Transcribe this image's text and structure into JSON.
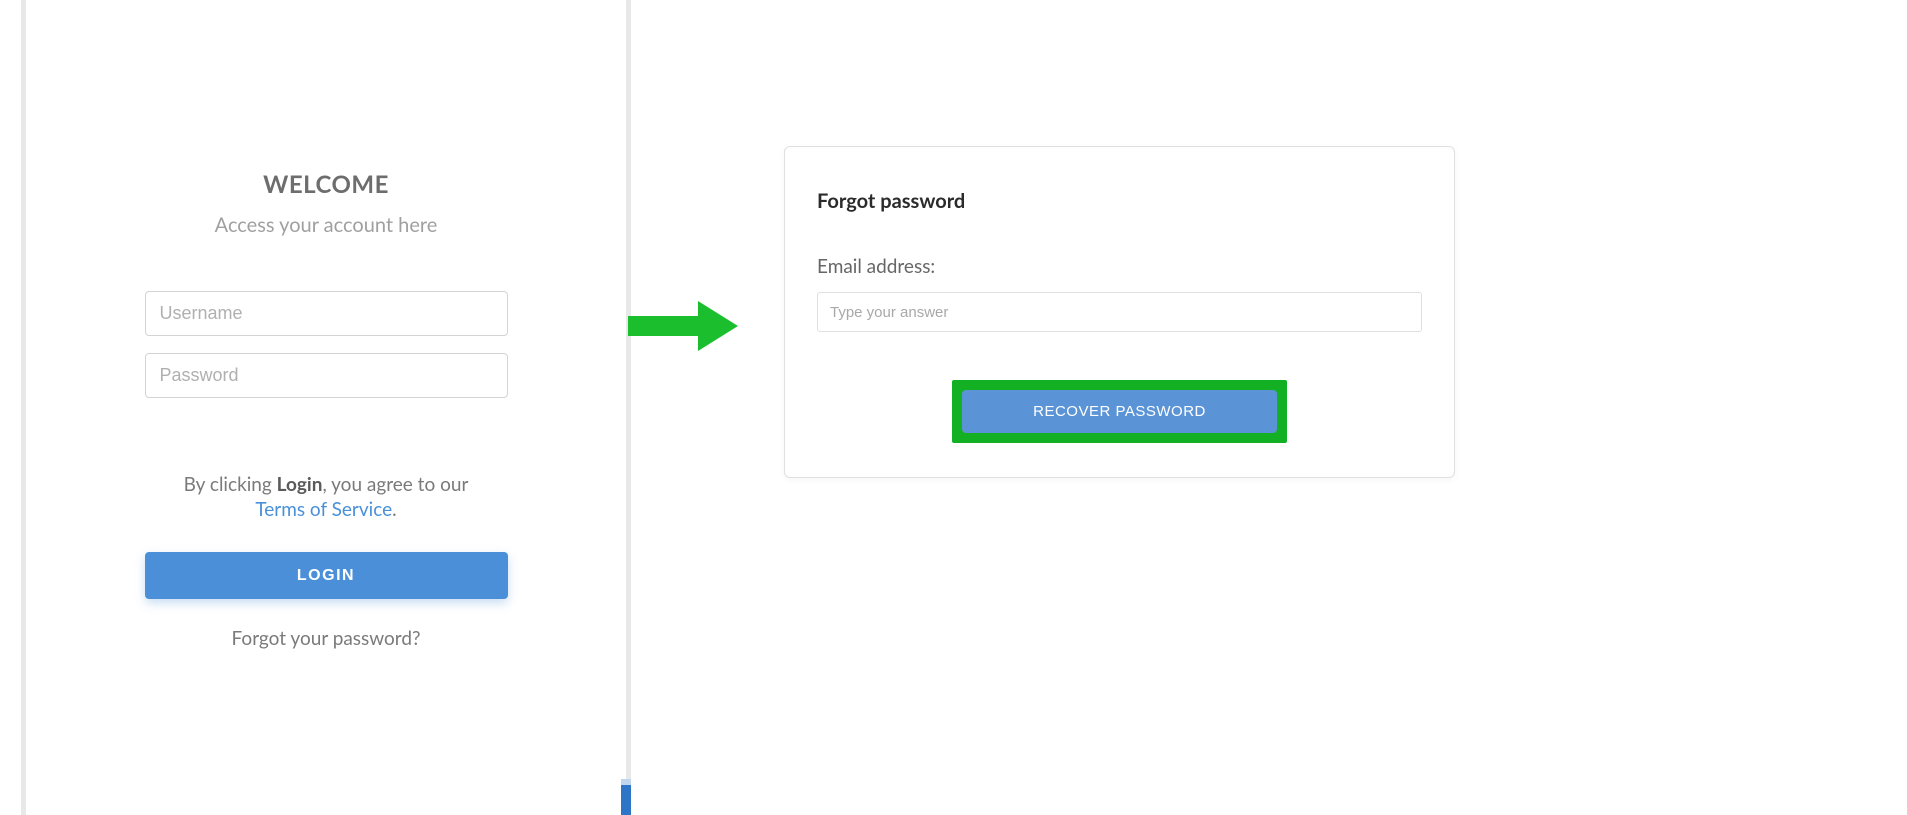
{
  "login": {
    "title": "WELCOME",
    "subtitle": "Access your account here",
    "username_placeholder": "Username",
    "password_placeholder": "Password",
    "agreement_prefix": "By clicking ",
    "agreement_bold": "Login",
    "agreement_suffix": ", you agree to our",
    "terms_link": "Terms of Service",
    "terms_period": ".",
    "login_button": "LOGIN",
    "forgot_link": "Forgot your password?"
  },
  "forgot": {
    "title": "Forgot password",
    "email_label": "Email address:",
    "email_placeholder": "Type your answer",
    "recover_button": "RECOVER PASSWORD"
  }
}
